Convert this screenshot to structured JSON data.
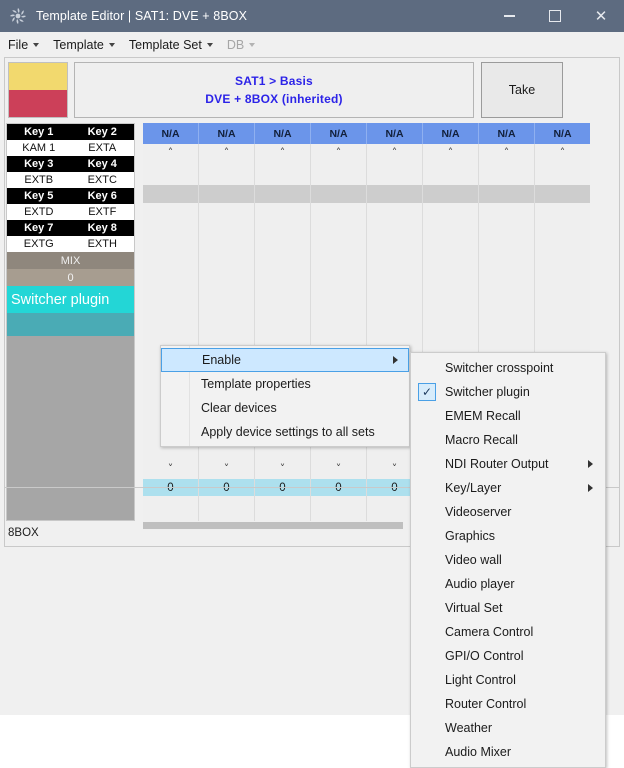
{
  "window": {
    "title": "Template Editor | SAT1: DVE + 8BOX",
    "icon": "gear-icon",
    "minimize_label": "—",
    "maximize_label": "□",
    "close_label": "✕"
  },
  "menubar": {
    "items": [
      {
        "label": "File",
        "has_caret": true,
        "disabled": false
      },
      {
        "label": "Template",
        "has_caret": true,
        "disabled": false
      },
      {
        "label": "Template Set",
        "has_caret": true,
        "disabled": false
      },
      {
        "label": "DB",
        "has_caret": true,
        "disabled": true
      }
    ]
  },
  "header": {
    "swatch": {
      "top_color": "#f2d96e",
      "bottom_color": "#cc4059"
    },
    "breadcrumb": "SAT1 > Basis",
    "template_name": "DVE + 8BOX (inherited)",
    "take_label": "Take"
  },
  "device_list": {
    "key_rows": [
      {
        "left_key": "Key 1",
        "right_key": "Key 2",
        "left_value": "KAM 1",
        "right_value": "EXTA"
      },
      {
        "left_key": "Key 3",
        "right_key": "Key 4",
        "left_value": "EXTB",
        "right_value": "EXTC"
      },
      {
        "left_key": "Key 5",
        "right_key": "Key 6",
        "left_value": "EXTD",
        "right_value": "EXTF"
      },
      {
        "left_key": "Key 7",
        "right_key": "Key 8",
        "left_value": "EXTG",
        "right_value": "EXTH"
      }
    ],
    "mix_label": "MIX",
    "mix_value": "0",
    "plugin_label": "Switcher plugin",
    "plugin_highlight_color": "#23d6d6"
  },
  "grid": {
    "column_count": 8,
    "header_value": "N/A",
    "header_color": "#6b95ea",
    "up_arrow": "˄",
    "down_arrow": "˅",
    "bottom_value": "0",
    "bottom_color": "#ade0ee"
  },
  "status": {
    "text": "8BOX"
  },
  "context_menu": {
    "items": [
      {
        "label": "Enable",
        "selected": true,
        "has_submenu": true
      },
      {
        "label": "Template properties",
        "selected": false,
        "has_submenu": false
      },
      {
        "label": "Clear devices",
        "selected": false,
        "has_submenu": false
      },
      {
        "label": "Apply device settings to all sets",
        "selected": false,
        "has_submenu": false
      }
    ]
  },
  "submenu": {
    "check_glyph": "✓",
    "items": [
      {
        "label": "Switcher crosspoint",
        "checked": false,
        "has_submenu": false
      },
      {
        "label": "Switcher plugin",
        "checked": true,
        "has_submenu": false
      },
      {
        "label": "EMEM Recall",
        "checked": false,
        "has_submenu": false
      },
      {
        "label": "Macro Recall",
        "checked": false,
        "has_submenu": false
      },
      {
        "label": "NDI Router Output",
        "checked": false,
        "has_submenu": true
      },
      {
        "label": "Key/Layer",
        "checked": false,
        "has_submenu": true
      },
      {
        "label": "Videoserver",
        "checked": false,
        "has_submenu": false
      },
      {
        "label": "Graphics",
        "checked": false,
        "has_submenu": false
      },
      {
        "label": "Video wall",
        "checked": false,
        "has_submenu": false
      },
      {
        "label": "Audio player",
        "checked": false,
        "has_submenu": false
      },
      {
        "label": "Virtual Set",
        "checked": false,
        "has_submenu": false
      },
      {
        "label": "Camera Control",
        "checked": false,
        "has_submenu": false
      },
      {
        "label": "GPI/O Control",
        "checked": false,
        "has_submenu": false
      },
      {
        "label": "Light Control",
        "checked": false,
        "has_submenu": false
      },
      {
        "label": "Router Control",
        "checked": false,
        "has_submenu": false
      },
      {
        "label": "Weather",
        "checked": false,
        "has_submenu": false
      },
      {
        "label": "Audio Mixer",
        "checked": false,
        "has_submenu": false
      }
    ]
  }
}
